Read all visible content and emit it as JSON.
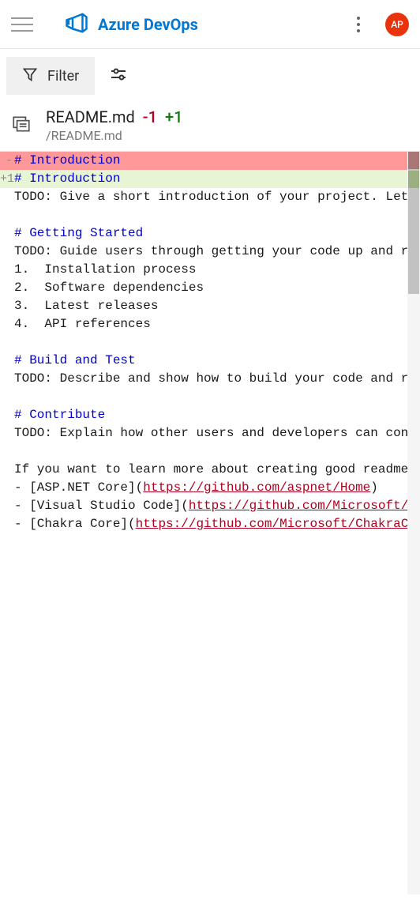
{
  "header": {
    "title": "Azure DevOps",
    "avatar_initials": "AP"
  },
  "toolbar": {
    "filter_label": "Filter"
  },
  "file": {
    "name": "README.md",
    "minus": "-1",
    "plus": "+1",
    "path": "/README.md"
  },
  "diff": {
    "lines": [
      {
        "type": "removed",
        "gutter": "-",
        "content": "# Introduction",
        "isHeading": true
      },
      {
        "type": "added",
        "gutter": "+1",
        "content": "# Introduction",
        "isHeading": true
      },
      {
        "type": "normal",
        "gutter": "",
        "content": "TODO: Give a short introduction of your project. Let this section explain the objectives or the motivation behind this project."
      },
      {
        "type": "normal",
        "gutter": "",
        "content": ""
      },
      {
        "type": "normal",
        "gutter": "",
        "content": "# Getting Started",
        "isHeading": true
      },
      {
        "type": "normal",
        "gutter": "",
        "content": "TODO: Guide users through getting your code up and running on their own system. In this section you can talk about:"
      },
      {
        "type": "normal",
        "gutter": "",
        "content": "1.  Installation process"
      },
      {
        "type": "normal",
        "gutter": "",
        "content": "2.  Software dependencies"
      },
      {
        "type": "normal",
        "gutter": "",
        "content": "3.  Latest releases"
      },
      {
        "type": "normal",
        "gutter": "",
        "content": "4.  API references"
      },
      {
        "type": "normal",
        "gutter": "",
        "content": ""
      },
      {
        "type": "normal",
        "gutter": "",
        "content": "# Build and Test",
        "isHeading": true
      },
      {
        "type": "normal",
        "gutter": "",
        "content": "TODO: Describe and show how to build your code and run the tests."
      },
      {
        "type": "normal",
        "gutter": "",
        "content": ""
      },
      {
        "type": "normal",
        "gutter": "",
        "content": "# Contribute",
        "isHeading": true
      },
      {
        "type": "normal",
        "gutter": "",
        "content": "TODO: Explain how other users and developers can contribute to make your code better."
      },
      {
        "type": "normal",
        "gutter": "",
        "content": ""
      },
      {
        "type": "normal",
        "gutter": "",
        "content": "If you want to learn more about creating good readme files then refer the following"
      },
      {
        "type": "normal",
        "gutter": "",
        "content": "- [ASP.NET Core](https://github.com/aspnet/Home)",
        "isLink": true,
        "linkStart": 16
      },
      {
        "type": "normal",
        "gutter": "",
        "content": "- [Visual Studio Code](https://github.com/Microsoft/vscode)",
        "isLink": true,
        "linkStart": 22
      },
      {
        "type": "normal",
        "gutter": "",
        "content": "- [Chakra Core](https://github.com/Microsoft/ChakraCore)",
        "isLink": true,
        "linkStart": 15
      }
    ]
  }
}
